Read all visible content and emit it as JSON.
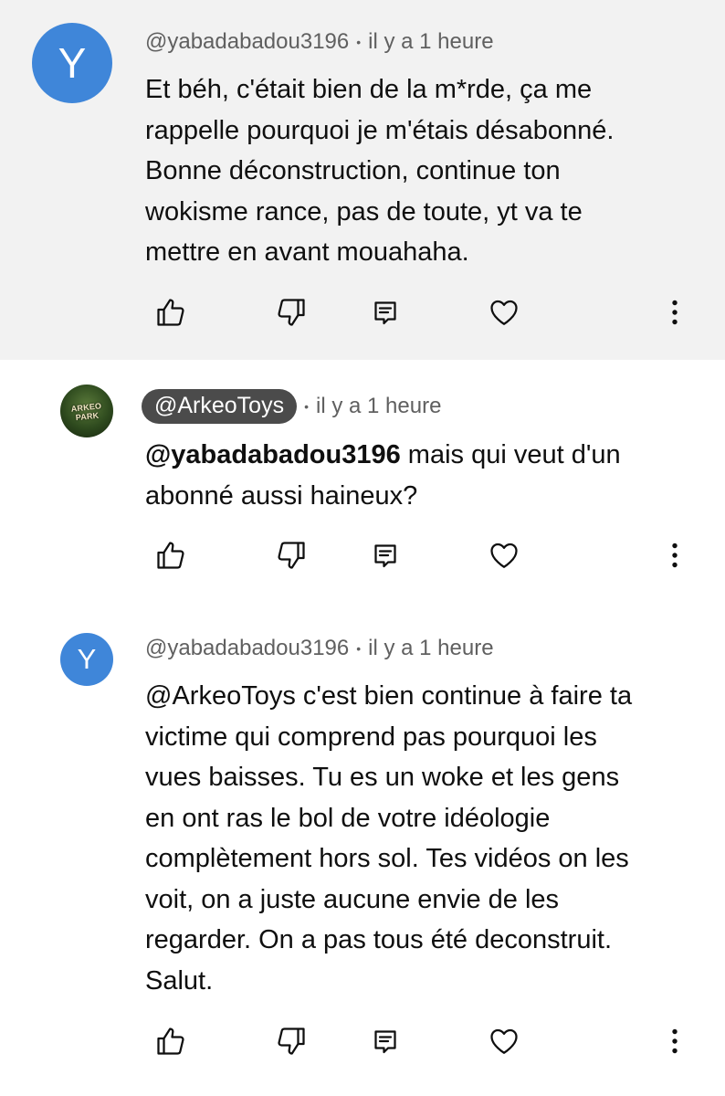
{
  "comments": [
    {
      "avatar_letter": "Y",
      "author": "@yabadabadou3196",
      "separator": "•",
      "time": "il y a 1 heure",
      "text": "Et béh, c'était bien de la m*rde, ça me\nrappelle pourquoi je m'étais désabonné.\nBonne déconstruction, continue ton\nwokisme rance, pas de toute, yt va te\nmettre en avant mouahaha."
    },
    {
      "avatar_logo_text": "ARKEO PARK",
      "author": "@ArkeoToys",
      "separator": "•",
      "time": "il y a 1 heure",
      "mention": "@yabadabadou3196",
      "text": " mais qui veut d'un\nabonné aussi haineux?"
    },
    {
      "avatar_letter": "Y",
      "author": "@yabadabadou3196",
      "separator": "•",
      "time": "il y a 1 heure",
      "text": "@ArkeoToys  c'est bien continue à faire ta\nvictime qui comprend pas pourquoi les\nvues baisses. Tu es un woke et les gens\nen ont ras le bol de votre idéologie\ncomplètement hors sol. Tes vidéos on les\nvoit, on a juste aucune envie de les\nregarder. On a pas tous été deconstruit.\nSalut."
    }
  ],
  "icons": {
    "like": "thumbs-up-icon",
    "dislike": "thumbs-down-icon",
    "reply": "reply-icon",
    "heart": "heart-icon",
    "more": "more-vertical-icon"
  },
  "colors": {
    "highlight_background": "#f2f2f2",
    "avatar_blue": "#3f86d9",
    "handle_chip": "#4b4b4b",
    "meta_text": "#606060"
  }
}
